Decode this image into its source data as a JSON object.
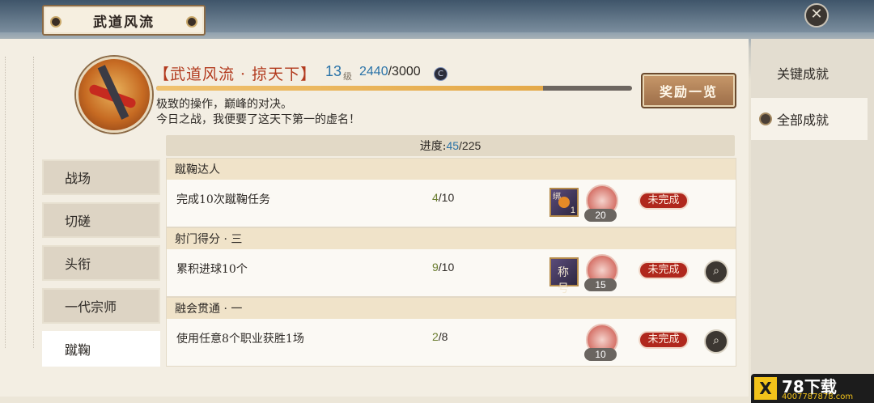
{
  "header": {
    "title": "武道风流"
  },
  "hero": {
    "title": "【武道风流 · 掠天下】",
    "level": "13",
    "level_unit": "级",
    "exp_current": "2440",
    "exp_total": "/3000",
    "currency_symbol": "C",
    "progress": 0.813,
    "desc_line1": "极致的操作，巅峰的对决。",
    "desc_line2": "今日之战，我便要了这天下第一的虚名！",
    "reward_button": "奖励一览"
  },
  "overall_progress": {
    "label": "进度:",
    "current": "45",
    "total": "/225"
  },
  "right_tabs": [
    "关键成就",
    "全部成就"
  ],
  "right_tabs_active_index": 1,
  "left_tabs": [
    "战场",
    "切磋",
    "头衔",
    "一代宗师",
    "蹴鞠"
  ],
  "left_tabs_active_index": 4,
  "achievements": [
    {
      "name": "蹴鞠达人",
      "description": "完成10次蹴鞠任务",
      "current": "4",
      "total": "/10",
      "item_count": "1",
      "item_label": "绑",
      "medal_count": "20",
      "status": "未完成"
    },
    {
      "name": "射门得分 · 三",
      "description": "累积进球10个",
      "current": "9",
      "total": "/10",
      "item_label": "称号",
      "medal_count": "15",
      "status": "未完成"
    },
    {
      "name": "融会贯通 · 一",
      "description": "使用任意8个职业获胜1场",
      "current": "2",
      "total": "/8",
      "medal_count": "10",
      "status": "未完成"
    }
  ],
  "watermark": {
    "logo": "X",
    "brand": "78下载",
    "site": "4007787878.com"
  },
  "icons": {
    "close": "close-icon",
    "search": "search-icon"
  }
}
